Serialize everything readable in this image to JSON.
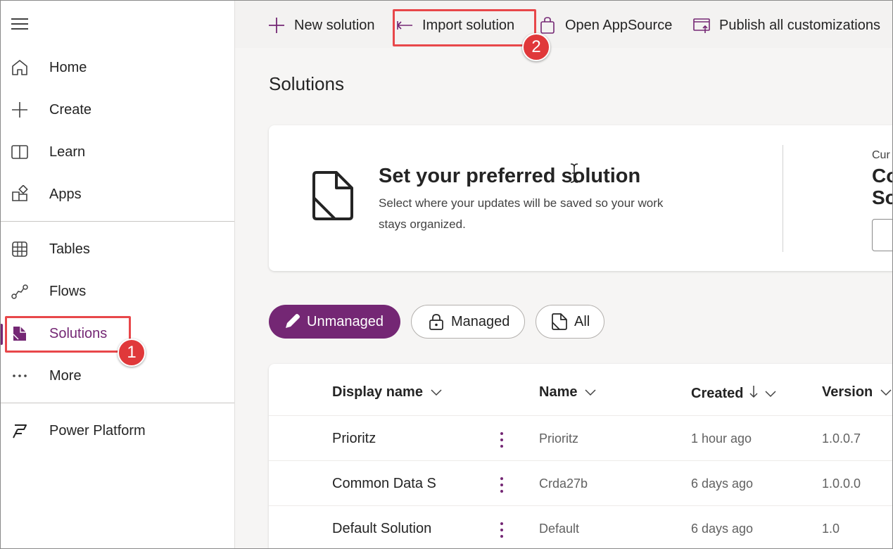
{
  "sidebar": {
    "items": [
      {
        "label": "Home",
        "icon": "home-icon"
      },
      {
        "label": "Create",
        "icon": "plus-icon"
      },
      {
        "label": "Learn",
        "icon": "book-icon"
      },
      {
        "label": "Apps",
        "icon": "apps-icon"
      },
      {
        "label": "Tables",
        "icon": "table-icon"
      },
      {
        "label": "Flows",
        "icon": "flow-icon"
      },
      {
        "label": "Solutions",
        "icon": "solutions-icon",
        "selected": true
      },
      {
        "label": "More",
        "icon": "more-icon"
      },
      {
        "label": "Power Platform",
        "icon": "power-platform-icon"
      }
    ]
  },
  "commandbar": {
    "new_solution": "New solution",
    "import_solution": "Import solution",
    "open_appsource": "Open AppSource",
    "publish_all": "Publish all customizations"
  },
  "page": {
    "title": "Solutions"
  },
  "preferred": {
    "title": "Set your preferred solution",
    "description": "Select where your updates will be saved so your work stays organized.",
    "current_label": "Cur",
    "current_name_line1": "Co",
    "current_name_line2": "So"
  },
  "filters": [
    {
      "label": "Unmanaged",
      "active": true
    },
    {
      "label": "Managed",
      "active": false
    },
    {
      "label": "All",
      "active": false
    }
  ],
  "table": {
    "columns": [
      "Display name",
      "Name",
      "Created",
      "Version"
    ],
    "rows": [
      {
        "display_name": "Prioritz",
        "name": "Prioritz",
        "created": "1 hour ago",
        "version": "1.0.0.7"
      },
      {
        "display_name": "Common Data S",
        "name": "Crda27b",
        "created": "6 days ago",
        "version": "1.0.0.0"
      },
      {
        "display_name": "Default Solution",
        "name": "Default",
        "created": "6 days ago",
        "version": "1.0"
      }
    ]
  },
  "annotations": {
    "step1": "1",
    "step2": "2"
  },
  "colors": {
    "accent": "#742774",
    "callout": "#e8474a"
  }
}
